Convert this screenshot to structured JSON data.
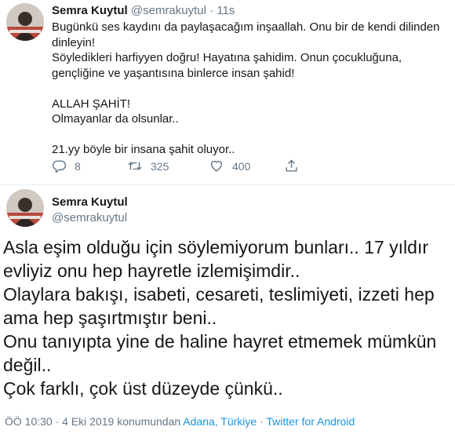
{
  "tweet1": {
    "name": "Semra Kuytul",
    "handle": "@semrakuytul",
    "separator": "·",
    "time": "11s",
    "lines": [
      "Bugünkü ses kaydını da paylaşacağım inşaallah. Onu bir de kendi dilinden",
      "dinleyin!",
      "Söyledikleri harfiyyen doğru! Hayatına şahidim. Onun çocukluğuna,",
      "gençliğine ve yaşantısına binlerce insan şahid!",
      "",
      "ALLAH ŞAHİT!",
      "Olmayanlar da olsunlar..",
      "",
      "21.yy böyle bir insana şahit oluyor.."
    ],
    "replies": "8",
    "retweets": "325",
    "likes": "400"
  },
  "tweet2": {
    "name": "Semra Kuytul",
    "handle": "@semrakuytul",
    "lines": [
      "Asla eşim olduğu için söylemiyorum bunları.. 17 yıldır",
      "evliyiz onu hep hayretle izlemişimdir..",
      "Olaylara bakışı, isabeti, cesareti, teslimiyeti, izzeti hep",
      "ama hep şaşırtmıştır beni..",
      "Onu tanıyıpta yine de haline hayret etmemek mümkün",
      "değil..",
      "Çok farklı, çok üst düzeyde çünkü.."
    ],
    "meta": {
      "time": "ÖÖ 10:30",
      "sep1": " · ",
      "date": "4 Eki 2019",
      "from": " konumundan ",
      "location": "Adana, Türkiye",
      "sep2": " · ",
      "source": "Twitter for Android"
    }
  },
  "icons": {
    "reply": "reply-icon",
    "retweet": "retweet-icon",
    "like": "heart-icon",
    "share": "share-icon"
  },
  "colors": {
    "text": "#14171a",
    "secondary": "#657786",
    "link": "#1b95e0",
    "divider": "#e6ecf0"
  }
}
